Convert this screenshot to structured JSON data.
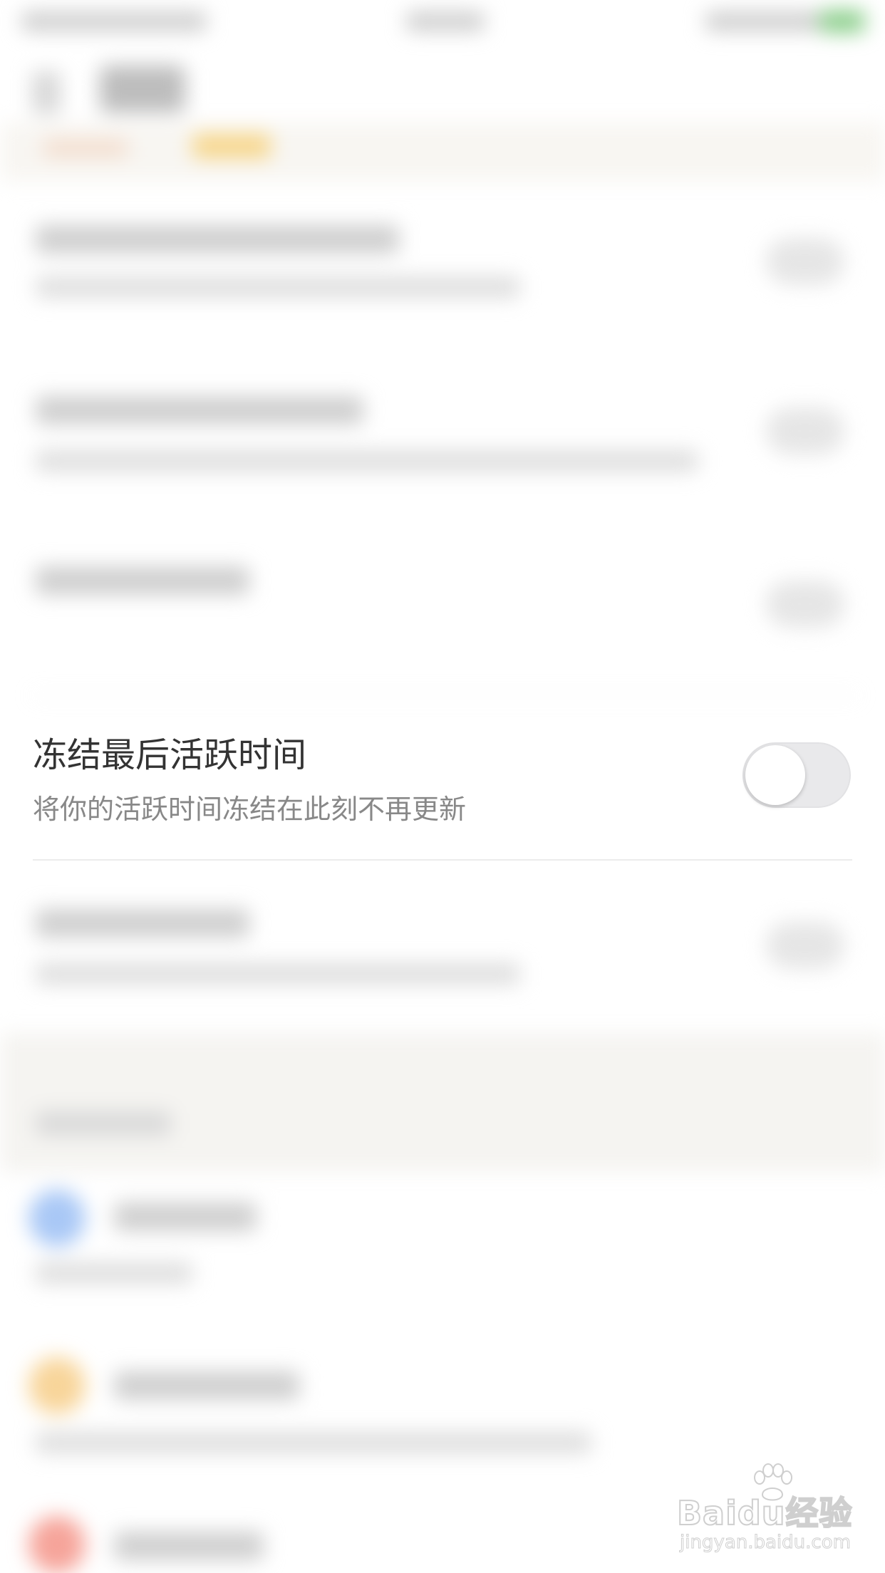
{
  "settings_row": {
    "title": "冻结最后活跃时间",
    "subtitle": "将你的活跃时间冻结在此刻不再更新",
    "toggle_on": false
  },
  "colors": {
    "title_text": "#333333",
    "subtitle_text": "#888888",
    "toggle_off_track": "#e9e9eb",
    "toggle_knob": "#ffffff",
    "section_band": "#f5f4f1",
    "battery": "#8ccf8c"
  },
  "watermark": {
    "brand": "Baidu经验",
    "url": "jingyan.baidu.com",
    "icon": "paw-icon"
  }
}
